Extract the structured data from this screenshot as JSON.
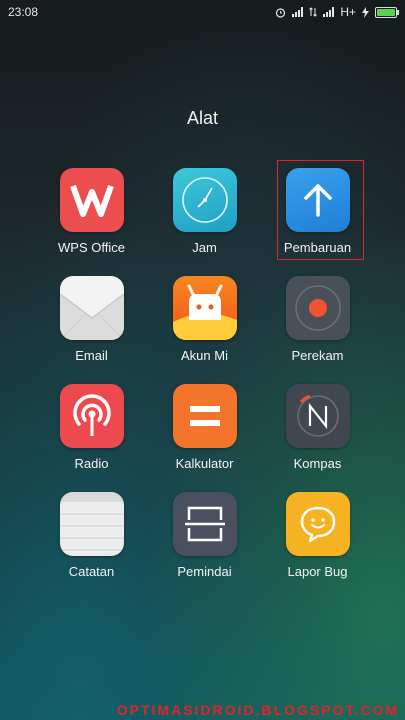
{
  "status_bar": {
    "time": "23:08",
    "network": "H+"
  },
  "folder": {
    "title": "Alat",
    "apps": [
      {
        "label": "WPS Office",
        "icon": "wps-office-icon",
        "color": "#ec4e4f"
      },
      {
        "label": "Jam",
        "icon": "clock-icon",
        "color": "#2bb5cf"
      },
      {
        "label": "Pembaruan",
        "icon": "update-arrow-icon",
        "color": "#2b8de0",
        "highlighted": true
      },
      {
        "label": "Email",
        "icon": "envelope-icon",
        "color": "#f1f1f1"
      },
      {
        "label": "Akun Mi",
        "icon": "mi-account-icon",
        "color": "#f5701f"
      },
      {
        "label": "Perekam",
        "icon": "recorder-icon",
        "color": "#4a5058"
      },
      {
        "label": "Radio",
        "icon": "radio-icon",
        "color": "#ec4a4e"
      },
      {
        "label": "Kalkulator",
        "icon": "calculator-icon",
        "color": "#f3742a"
      },
      {
        "label": "Kompas",
        "icon": "compass-icon",
        "color": "#414751"
      },
      {
        "label": "Catatan",
        "icon": "notes-icon",
        "color": "#ececec"
      },
      {
        "label": "Pemindai",
        "icon": "scanner-icon",
        "color": "#4a5060"
      },
      {
        "label": "Lapor Bug",
        "icon": "bug-report-icon",
        "color": "#f5b323"
      }
    ]
  },
  "watermark": "OPTIMASIDROID.BLOGSPOT.COM"
}
